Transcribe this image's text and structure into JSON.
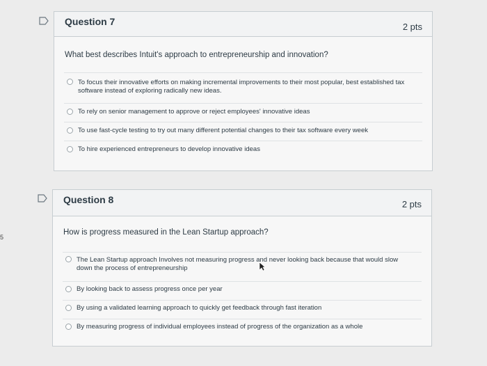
{
  "edge_char": "5",
  "questions": [
    {
      "title": "Question 7",
      "points": "2 pts",
      "prompt": "What best describes Intuit's approach to entrepreneurship and innovation?",
      "answers": [
        "To focus their innovative efforts on making incremental improvements to their most popular, best established tax software instead of exploring radically new ideas.",
        "To rely on senior management to approve or reject employees' innovative ideas",
        "To use fast-cycle testing to try out many different potential changes to their tax software every week",
        "To hire experienced entrepreneurs to develop innovative ideas"
      ]
    },
    {
      "title": "Question 8",
      "points": "2 pts",
      "prompt": "How is progress measured in the Lean Startup approach?",
      "answers": [
        "The Lean Startup approach Involves not measuring progress and never looking back because that would slow down the process of entrepreneurship",
        "By looking back to assess progress once per year",
        "By using a validated learning approach to quickly get feedback through fast iteration",
        "By measuring progress of individual employees instead of progress of the organization as a whole"
      ]
    }
  ],
  "colors": {
    "card_bg": "#f7f7f7",
    "header_bg": "#f2f3f4",
    "border": "#c7cdd1",
    "text": "#2d3b45"
  },
  "icons": [
    "flag-icon",
    "radio-button",
    "cursor-icon"
  ]
}
